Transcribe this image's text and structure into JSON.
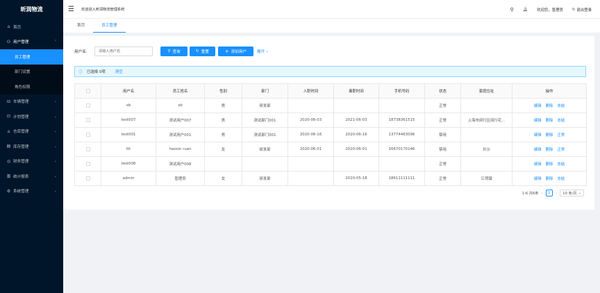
{
  "app": {
    "logo": "昕润物流"
  },
  "sidebar": {
    "items": [
      {
        "label": "首页",
        "icon": "home-icon",
        "glyph": "⌂"
      },
      {
        "label": "用户管理",
        "icon": "user-icon",
        "glyph": "⚇",
        "open": true,
        "children": [
          {
            "label": "员工管理",
            "active": true
          },
          {
            "label": "部门设置"
          },
          {
            "label": "角色权限"
          }
        ]
      },
      {
        "label": "车辆管理",
        "icon": "car-icon",
        "glyph": "⊟",
        "chevron": "⌄"
      },
      {
        "label": "计划管理",
        "icon": "plan-icon",
        "glyph": "⊡",
        "chevron": "⌄"
      },
      {
        "label": "仓库管理",
        "icon": "warehouse-icon",
        "glyph": "⌂",
        "chevron": "⌄"
      },
      {
        "label": "库存管理",
        "icon": "inventory-icon",
        "glyph": "▤",
        "chevron": "⌄"
      },
      {
        "label": "财务管理",
        "icon": "finance-icon",
        "glyph": "◎",
        "chevron": "⌄"
      },
      {
        "label": "统计报表",
        "icon": "report-icon",
        "glyph": "▥",
        "chevron": "⌄"
      },
      {
        "label": "系统管理",
        "icon": "settings-icon",
        "glyph": "⚙",
        "chevron": "⌄"
      }
    ]
  },
  "header": {
    "menu_glyph": "☰",
    "welcome": "欢迎进入昕润物流管理系统",
    "search_glyph": "⚲",
    "bell_glyph": "🔔",
    "greeting": "欢迎您，管理员",
    "logout_glyph": "↻",
    "logout": "退出登录"
  },
  "tabs": [
    {
      "label": "首页",
      "active": false
    },
    {
      "label": "员工管理",
      "active": true
    }
  ],
  "filter": {
    "label": "用户名:",
    "placeholder": "请输入用户名",
    "query_glyph": "⚲",
    "query": "查询",
    "reset_glyph": "↻",
    "reset": "重置",
    "add_glyph": "+",
    "add": "添加用户",
    "expand": "展开",
    "expand_glyph": "⌄"
  },
  "alert": {
    "glyph": "ⓘ",
    "selected": "已选择 0项",
    "clear": "清空"
  },
  "table": {
    "columns": [
      "用户名",
      "员工姓名",
      "性别",
      "部门",
      "入职时间",
      "离职时间",
      "手机号码",
      "状态",
      "家庭住址",
      "操作"
    ],
    "rows": [
      {
        "username": "xb",
        "name": "xb",
        "gender": "男",
        "dept": "研发部",
        "join": "",
        "leave": "",
        "phone": "",
        "status": "正常",
        "address": "",
        "ops": [
          "编辑",
          "删除",
          "冻结"
        ]
      },
      {
        "username": "test007",
        "name": "测试用户007",
        "gender": "男",
        "dept": "测试部门001",
        "join": "2020-06-03",
        "leave": "2021-06-03",
        "phone": "18738361515",
        "status": "正常",
        "address": "上海市闵行区闵行花...",
        "ops": [
          "编辑",
          "删除",
          "冻结"
        ]
      },
      {
        "username": "test001",
        "name": "测试用户001",
        "gender": "男",
        "dept": "测试部门001",
        "join": "2020-06-16",
        "leave": "2020-06-16",
        "phone": "13774463096",
        "status": "禁用",
        "address": "",
        "ops": [
          "编辑",
          "删除",
          "正常"
        ]
      },
      {
        "username": "ttt",
        "name": "haoxin ruan",
        "gender": "女",
        "dept": "研发部",
        "join": "2020-06-01",
        "leave": "2020-06-01",
        "phone": "16670170146",
        "status": "禁用",
        "address": "长沙",
        "ops": [
          "编辑",
          "删除",
          "正常"
        ]
      },
      {
        "username": "test008",
        "name": "测试用户008",
        "gender": "",
        "dept": "",
        "join": "",
        "leave": "",
        "phone": "",
        "status": "正常",
        "address": "",
        "ops": [
          "编辑",
          "删除",
          "冻结"
        ]
      },
      {
        "username": "admin",
        "name": "管理员",
        "gender": "女",
        "dept": "研发部",
        "join": "",
        "leave": "2020-05-18",
        "phone": "18611111111",
        "status": "正常",
        "address": "江湾镇",
        "ops": [
          "编辑",
          "删除",
          "冻结"
        ]
      }
    ]
  },
  "pager": {
    "total": "1-6 共6条",
    "prev": "‹",
    "page": "1",
    "next": "›",
    "size": "10 条/页",
    "size_glyph": "⌄"
  }
}
